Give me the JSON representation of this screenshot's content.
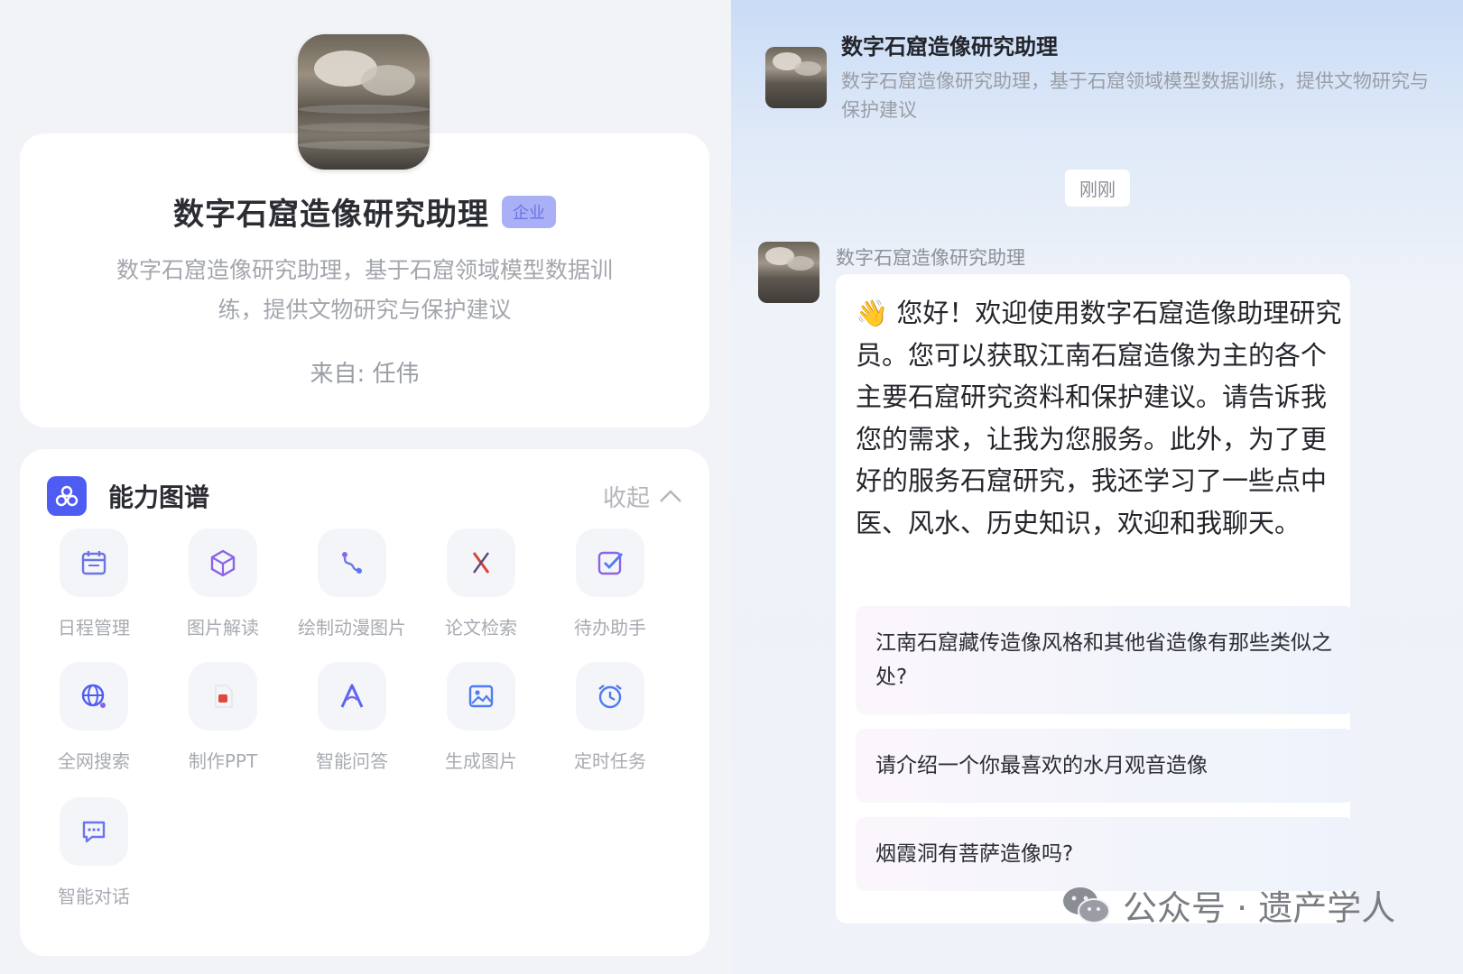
{
  "assistant": {
    "name": "数字石窟造像研究助理",
    "badge": "企业",
    "description": "数字石窟造像研究助理，基于石窟领域模型数据训练，提供文物研究与保护建议",
    "from_label": "来自: 任伟"
  },
  "capabilities": {
    "title": "能力图谱",
    "toggle_label": "收起",
    "tools": [
      {
        "label": "日程管理",
        "icon": "calendar-icon"
      },
      {
        "label": "图片解读",
        "icon": "cube-icon"
      },
      {
        "label": "绘制动漫图片",
        "icon": "path-icon"
      },
      {
        "label": "论文检索",
        "icon": "cross-icon"
      },
      {
        "label": "待办助手",
        "icon": "checkbox-icon"
      },
      {
        "label": "全网搜索",
        "icon": "globe-icon"
      },
      {
        "label": "制作PPT",
        "icon": "ppt-file-icon"
      },
      {
        "label": "智能问答",
        "icon": "letter-a-icon"
      },
      {
        "label": "生成图片",
        "icon": "image-icon"
      },
      {
        "label": "定时任务",
        "icon": "alarm-clock-icon"
      },
      {
        "label": "智能对话",
        "icon": "chat-icon"
      }
    ]
  },
  "chat": {
    "header_title": "数字石窟造像研究助理",
    "header_desc": "数字石窟造像研究助理，基于石窟领域模型数据训练，提供文物研究与保护建议",
    "timestamp": "刚刚",
    "sender": "数字石窟造像研究助理",
    "greeting_emoji": "👋",
    "greeting": "您好！欢迎使用数字石窟造像助理研究员。您可以获取江南石窟造像为主的各个主要石窟研究资料和保护建议。请告诉我您的需求，让我为您服务。此外，为了更好的服务石窟研究，我还学习了一些点中医、风水、历史知识，欢迎和我聊天。",
    "suggestions": [
      "江南石窟藏传造像风格和其他省造像有那些类似之处?",
      "请介绍一个你最喜欢的水月观音造像",
      "烟霞洞有菩萨造像吗?"
    ]
  },
  "watermark": {
    "text": "公众号 · 遗产学人",
    "icon": "wechat-icon"
  },
  "colors": {
    "accent": "#4f5cf2",
    "badge_bg": "#a9b0f5",
    "tool_icon": "#6b74e8"
  }
}
